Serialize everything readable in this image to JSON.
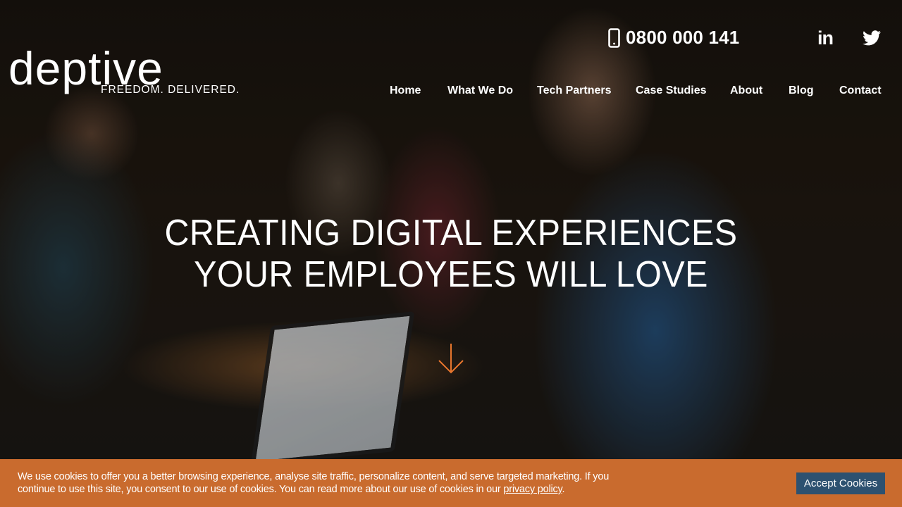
{
  "brand": {
    "name": "deptive",
    "tagline": "FREEDOM. DELIVERED."
  },
  "contact": {
    "phone_icon": "mobile-phone-icon",
    "phone": "0800 000 141"
  },
  "social": [
    {
      "name": "LinkedIn",
      "icon": "linkedin-icon",
      "glyph": "in"
    },
    {
      "name": "Twitter",
      "icon": "twitter-icon"
    }
  ],
  "nav": {
    "items": [
      {
        "label": "Home"
      },
      {
        "label": "What We Do"
      },
      {
        "label": "Tech Partners"
      },
      {
        "label": "Case Studies"
      },
      {
        "label": "About"
      },
      {
        "label": "Blog"
      },
      {
        "label": "Contact"
      }
    ]
  },
  "hero": {
    "headline_line1": "CREATING DIGITAL EXPERIENCES",
    "headline_line2": "YOUR EMPLOYEES WILL LOVE",
    "scroll_icon": "arrow-down-icon",
    "accent_color": "#e8762d"
  },
  "cookie_banner": {
    "text": "We use cookies to offer you a better browsing experience, analyse site traffic, personalize content, and serve targeted marketing. If you continue to use this site, you consent to our use of cookies. You can read more about our use of cookies in our ",
    "link_label": "privacy policy",
    "text_end": ".",
    "accept_label": "Accept Cookies",
    "background_color": "#c96b2e",
    "button_color": "#2d5170"
  }
}
